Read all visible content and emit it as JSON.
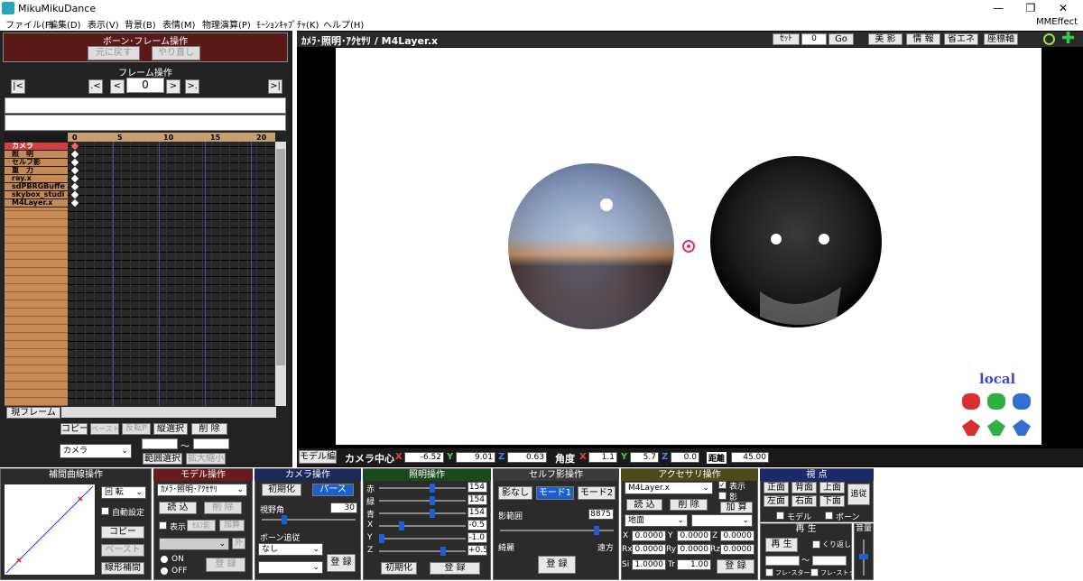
{
  "window": {
    "title": "MikuMikuDance",
    "min": "—",
    "max": "❐",
    "close": "✕"
  },
  "menu": [
    "ファイル(F)",
    "編集(D)",
    "表示(V)",
    "背景(B)",
    "表情(M)",
    "物理演算(P)",
    "ﾓｰｼｮﾝｷｬﾌﾟﾁｬ(K)",
    "ヘルプ(H)"
  ],
  "mmeffect": "MMEffect",
  "bone_frame": {
    "title": "ボーン･フレーム操作",
    "undo": "元に戻す",
    "redo": "やり直し"
  },
  "frame_ops": {
    "title": "フレーム操作",
    "first": "|<",
    "prev_key": ".<",
    "prev": "<",
    "frame": "0",
    "next": ">",
    "next_key": ">.",
    "last": ">|"
  },
  "timeline": {
    "ticks": [
      "0",
      "5",
      "10",
      "15",
      "20"
    ],
    "rows": [
      "カメラ",
      "照　明",
      "セルフ影",
      "重　力",
      "ray.x",
      "sdPBRGBuffe",
      "skybox_studi",
      "M4Layer.x"
    ],
    "current_frame_label": "現フレーム"
  },
  "edit_buttons": {
    "copy": "コピー",
    "paste": "ペースト",
    "reverse": "反転P",
    "vsel": "縦選択",
    "delete": "削 除",
    "target": "カメラ",
    "range_sel": "範囲選択",
    "zoom": "拡大縮小",
    "tilde": "〜"
  },
  "viewport": {
    "title": "ｶﾒﾗ･照明･ｱｸｾｻﾘ / M4Layer.x",
    "set": "ｾｯﾄ",
    "set_value": "0",
    "go": "Go",
    "beauty": "美 影",
    "info": "情 報",
    "eco": "省エネ",
    "axis": "座標軸",
    "local": "local",
    "model_edit": "モデル編",
    "center_label": "カメラ中心",
    "cx": "-6.52",
    "cy": "9.01",
    "cz": "0.63",
    "angle_label": "角度",
    "ax": "1.1",
    "ay": "5.7",
    "az": "0.0",
    "dist_label": "距離",
    "dist": "45.00",
    "x": "X",
    "y": "Y",
    "z": "Z"
  },
  "interp": {
    "title": "補間曲線操作",
    "rotate": "回 転",
    "auto": "自動設定",
    "copy": "コピー",
    "paste": "ペースト",
    "linear": "線形補間"
  },
  "model": {
    "title": "モデル操作",
    "target": "ｶﾒﾗ･照明･ｱｸｾｻﾘ",
    "load": "読 込",
    "delete": "削 除",
    "display": "表示",
    "selfshadow": "ｾﾙﾌ影",
    "add": "加算",
    "outer": "外",
    "on": "ON",
    "off": "OFF",
    "register": "登 録"
  },
  "camera": {
    "title": "カメラ操作",
    "init": "初期化",
    "perspective": "パース",
    "fov_label": "視野角",
    "fov": "30",
    "follow_label": "ボーン追従",
    "follow": "なし",
    "register": "登 録"
  },
  "light": {
    "title": "照明操作",
    "r": "赤",
    "g": "緑",
    "b": "青",
    "x": "X",
    "y": "Y",
    "z": "Z",
    "rv": "154",
    "gv": "154",
    "bv": "154",
    "xv": "-0.5",
    "yv": "-1.0",
    "zv": "+0.5",
    "init": "初期化",
    "register": "登 録"
  },
  "selfshadow": {
    "title": "セルフ影操作",
    "none": "影なし",
    "mode1": "モード1",
    "mode2": "モード2",
    "range_label": "影範囲",
    "range": "8875",
    "near": "綺麗",
    "far": "遠方",
    "register": "登 録"
  },
  "accessory": {
    "title": "アクセサリ操作",
    "name": "M4Layer.x",
    "show": "表示",
    "shadow": "影",
    "load": "読 込",
    "delete": "削 除",
    "add": "加 算",
    "ground": "地面",
    "x": "0.0000",
    "y": "0.0000",
    "z": "0.0000",
    "rx": "0.0000",
    "ry": "0.0000",
    "rz": "0.0000",
    "si": "1.0000",
    "tr": "1.00",
    "lx": "X",
    "ly": "Y",
    "lz": "Z",
    "lrx": "Rx",
    "lry": "Ry",
    "lrz": "Rz",
    "lsi": "Si",
    "ltr": "Tr",
    "register": "登 録"
  },
  "view": {
    "title": "視 点",
    "front": "正面",
    "back": "背面",
    "top": "上面",
    "left": "左面",
    "right": "右面",
    "bottom": "下面",
    "follow": "追従",
    "model": "モデル",
    "bone": "ボーン"
  },
  "play": {
    "title": "再 生",
    "play": "再 生",
    "repeat": "くり返し",
    "from": "フレ･スタート",
    "to": "フレ･ストップ",
    "tilde": "〜"
  },
  "volume": {
    "title": "音量"
  }
}
